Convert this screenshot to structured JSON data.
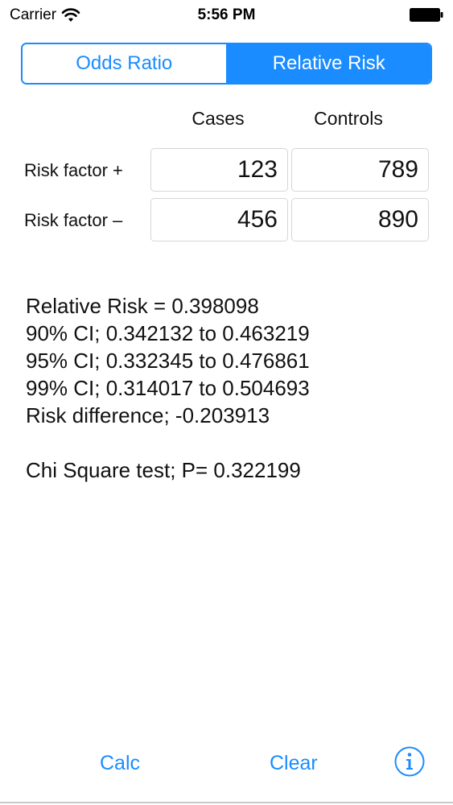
{
  "status": {
    "carrier": "Carrier",
    "time": "5:56 PM"
  },
  "segments": [
    {
      "label": "Odds Ratio",
      "selected": false
    },
    {
      "label": "Relative Risk",
      "selected": true
    }
  ],
  "table": {
    "columns": [
      "Cases",
      "Controls"
    ],
    "rows": [
      {
        "label": "Risk factor +",
        "cases": "123",
        "controls": "789"
      },
      {
        "label": "Risk factor –",
        "cases": "456",
        "controls": "890"
      }
    ]
  },
  "results": {
    "relative_risk": "Relative Risk = 0.398098",
    "ci90": "90% CI; 0.342132 to 0.463219",
    "ci95": "95% CI; 0.332345 to 0.476861",
    "ci99": "99% CI; 0.314017 to 0.504693",
    "risk_difference": "Risk difference; -0.203913",
    "chi_square": "Chi Square test; P= 0.322199"
  },
  "toolbar": {
    "calc_label": "Calc",
    "clear_label": "Clear",
    "info_icon": "info-icon"
  },
  "colors": {
    "accent": "#1a8cff"
  }
}
